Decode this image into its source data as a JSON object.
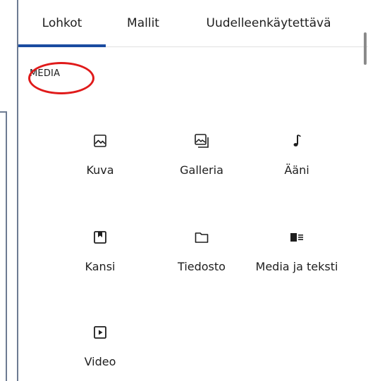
{
  "tabs": [
    {
      "label": "Lohkot",
      "active": true
    },
    {
      "label": "Mallit",
      "active": false
    },
    {
      "label": "Uudelleenkäytettävä",
      "active": false
    }
  ],
  "section": {
    "title": "MEDIA",
    "highlighted": true
  },
  "blocks": [
    {
      "label": "Kuva",
      "icon": "image-icon"
    },
    {
      "label": "Galleria",
      "icon": "gallery-icon"
    },
    {
      "label": "Ääni",
      "icon": "audio-icon"
    },
    {
      "label": "Kansi",
      "icon": "cover-icon"
    },
    {
      "label": "Tiedosto",
      "icon": "file-icon"
    },
    {
      "label": "Media ja teksti",
      "icon": "media-text-icon"
    },
    {
      "label": "Video",
      "icon": "video-icon"
    }
  ],
  "colors": {
    "accent": "#1a4ba0",
    "highlight": "#e01a1a",
    "border": "#6d7b92",
    "text": "#1e1e1e"
  }
}
